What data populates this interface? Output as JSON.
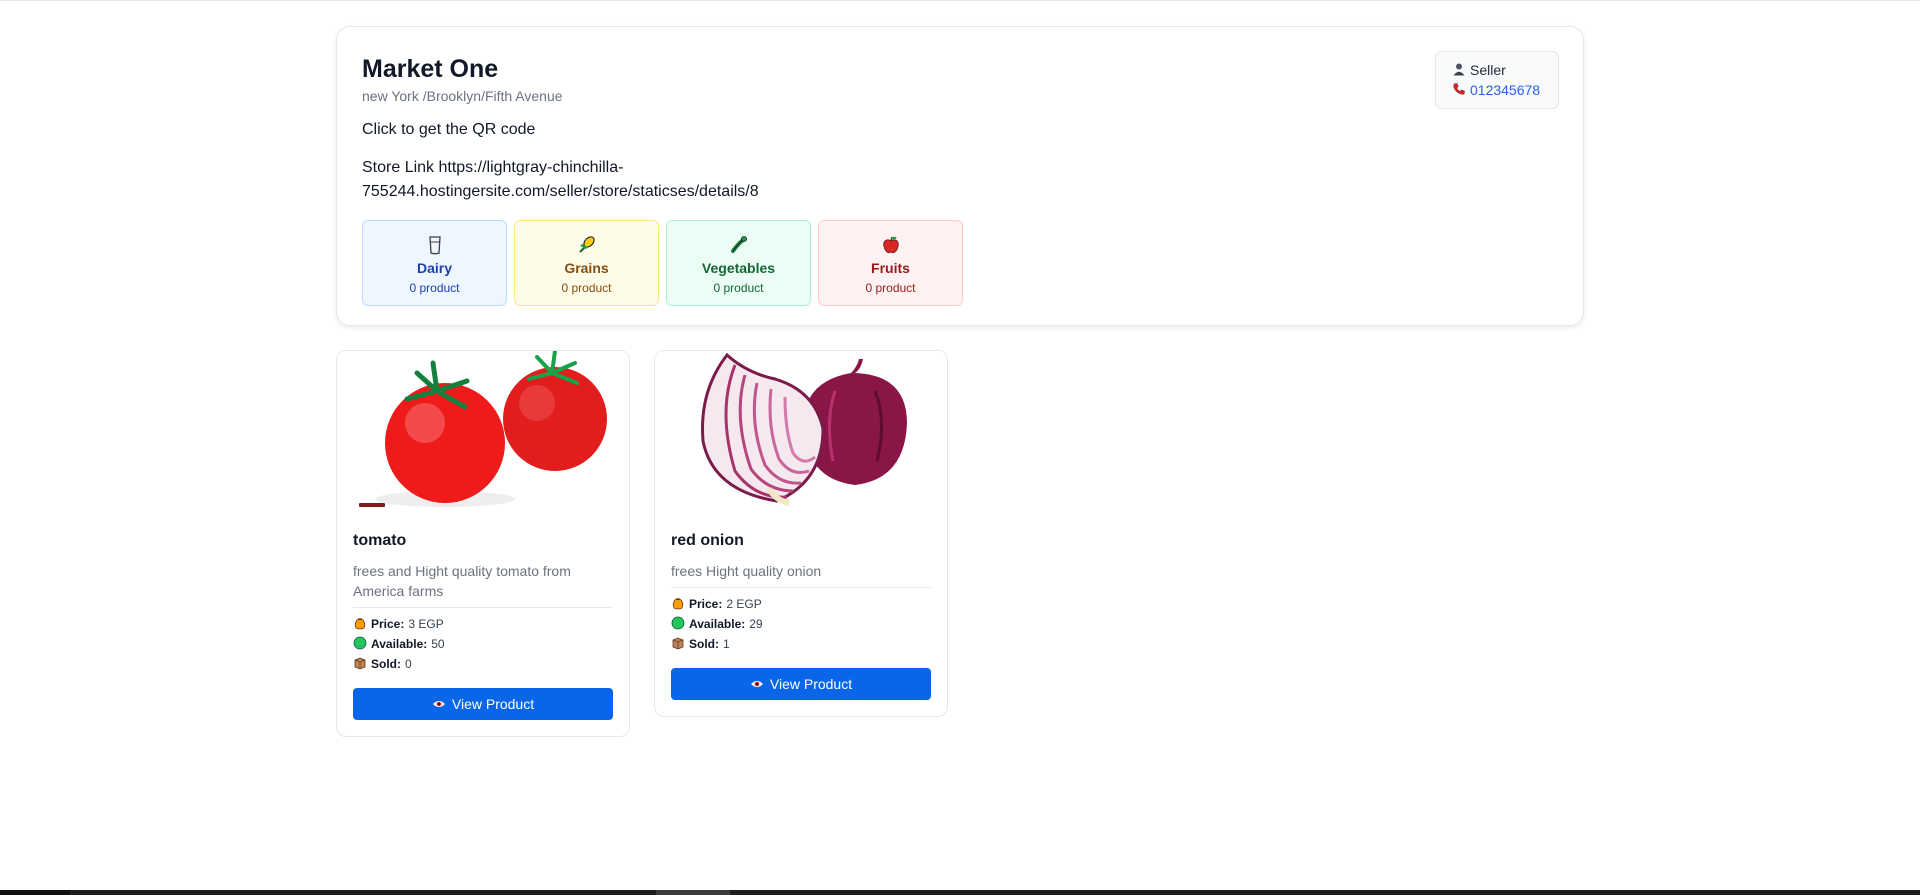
{
  "store": {
    "name": "Market One",
    "address": "new York /Brooklyn/Fifth Avenue",
    "qr_text": "Click to get the QR code",
    "link_text": "Store Link https://lightgray-chinchilla-755244.hostingersite.com/seller/store/staticses/details/8",
    "seller": {
      "icon": "person-icon",
      "label": "Seller",
      "phone_icon": "phone-icon",
      "phone": "012345678"
    }
  },
  "categories": [
    {
      "icon": "milk-icon",
      "name": "Dairy",
      "count": "0 product",
      "bg": "#eef6ff",
      "border": "#bfdbfe",
      "color": "#1e40af"
    },
    {
      "icon": "grain-icon",
      "name": "Grains",
      "count": "0 product",
      "bg": "#fefce8",
      "border": "#fde68a",
      "color": "#854d0e"
    },
    {
      "icon": "vegetable-icon",
      "name": "Vegetables",
      "count": "0 product",
      "bg": "#ecfdf5",
      "border": "#a7f3d0",
      "color": "#166534"
    },
    {
      "icon": "apple-icon",
      "name": "Fruits",
      "count": "0 product",
      "bg": "#fef2f2",
      "border": "#fecaca",
      "color": "#991b1b"
    }
  ],
  "products": [
    {
      "name": "tomato",
      "description": "frees and Hight quality tomato from America farms",
      "price_label": "Price:",
      "price": "3 EGP",
      "available_label": "Available:",
      "available": "50",
      "sold_label": "Sold:",
      "sold": "0",
      "button": "View Product",
      "image": "tomato"
    },
    {
      "name": "red onion",
      "description": "frees Hight quality onion",
      "price_label": "Price:",
      "price": "2 EGP",
      "available_label": "Available:",
      "available": "29",
      "sold_label": "Sold:",
      "sold": "1",
      "button": "View Product",
      "image": "red-onion"
    }
  ],
  "colors": {
    "primary": "#0a66e8",
    "link": "#2563eb"
  }
}
